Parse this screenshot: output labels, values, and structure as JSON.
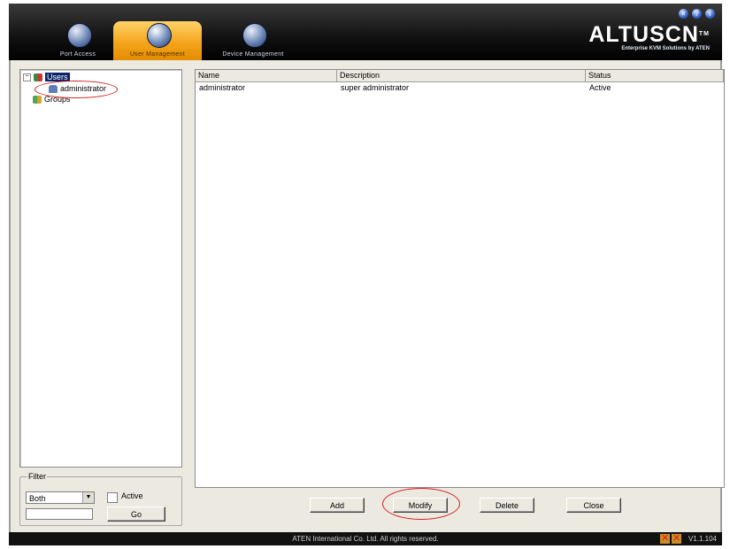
{
  "header": {
    "tabs": [
      {
        "label": "Port Access",
        "icon": "port-access-icon",
        "active": false
      },
      {
        "label": "User Management",
        "icon": "user-management-icon",
        "active": true
      },
      {
        "label": "Device Management",
        "icon": "device-management-icon",
        "active": false
      }
    ],
    "brand": {
      "logo": "ALTUSCN",
      "tm": "TM",
      "tagline": "Enterprise KVM Solutions by ATEN"
    },
    "window_buttons": [
      "logout-icon",
      "help-icon",
      "info-icon"
    ]
  },
  "tree": {
    "root": {
      "label": "Users",
      "icon": "users-icon",
      "expanded": true,
      "selected": true
    },
    "children": [
      {
        "label": "administrator",
        "icon": "user-icon"
      }
    ],
    "groups": {
      "label": "Groups",
      "icon": "groups-icon"
    }
  },
  "filter": {
    "legend": "Filter",
    "select_value": "Both",
    "active_label": "Active",
    "active_checked": false,
    "text_value": "",
    "go_label": "Go"
  },
  "list": {
    "columns": [
      "Name",
      "Description",
      "Status"
    ],
    "rows": [
      {
        "name": "administrator",
        "description": "super administrator",
        "status": "Active"
      }
    ]
  },
  "buttons": {
    "add": "Add",
    "modify": "Modify",
    "delete": "Delete",
    "close": "Close"
  },
  "statusbar": {
    "copyright": "ATEN International Co. Ltd. All rights reserved.",
    "version": "V1.1.104"
  },
  "colors": {
    "active_tab": "#f4a51c",
    "selection": "#0a246a",
    "annotation": "#d42020"
  }
}
